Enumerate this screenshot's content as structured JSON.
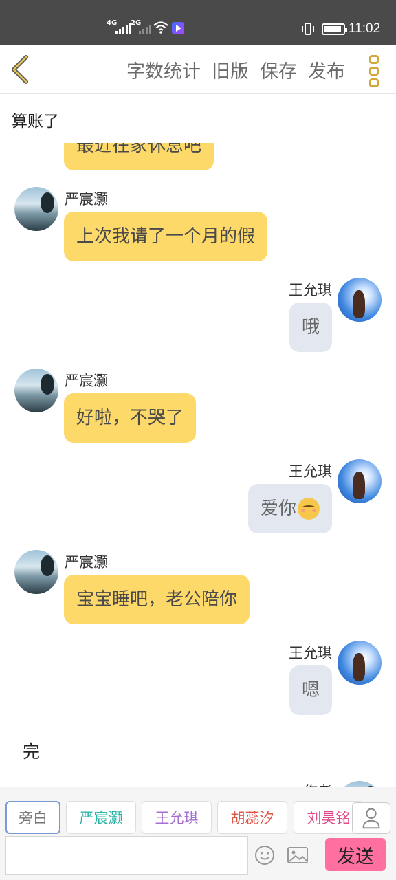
{
  "status_bar": {
    "net1": "4G",
    "net2": "2G",
    "time": "11:02",
    "icons": [
      "signal-icon",
      "wifi-icon",
      "app-icon",
      "vibrate-icon",
      "battery-icon"
    ]
  },
  "toolbar": {
    "back_icon": "chevron-left-icon",
    "word_count": "字数统计",
    "old_version": "旧版",
    "save": "保存",
    "publish": "发布",
    "more_icon": "more-vertical-icon",
    "accent": "#d4a73b"
  },
  "title": "算账了",
  "messages": [
    {
      "side": "left",
      "name": "",
      "text": "最近在家休息吧"
    },
    {
      "side": "left",
      "name": "严宸灏",
      "text": "上次我请了一个月的假"
    },
    {
      "side": "right",
      "name": "王允琪",
      "text": "哦"
    },
    {
      "side": "left",
      "name": "严宸灏",
      "text": "好啦，不哭了"
    },
    {
      "side": "right",
      "name": "王允琪",
      "text": "爱你",
      "emoji": "kissing-face-emoji"
    },
    {
      "side": "left",
      "name": "严宸灏",
      "text": "宝宝睡吧，老公陪你"
    },
    {
      "side": "right",
      "name": "王允琪",
      "text": "嗯"
    },
    {
      "side": "narration",
      "text": "完"
    },
    {
      "side": "right",
      "name": "作者",
      "text": ""
    }
  ],
  "roles": [
    {
      "label": "旁白",
      "color": "#777777",
      "active": true
    },
    {
      "label": "严宸灏",
      "color": "#2bb5a8",
      "active": false
    },
    {
      "label": "王允琪",
      "color": "#a36fd0",
      "active": false
    },
    {
      "label": "胡蕊汐",
      "color": "#e0584a",
      "active": false
    },
    {
      "label": "刘昊铭",
      "color": "#e04a8a",
      "active": false
    }
  ],
  "input": {
    "value": "",
    "placeholder": "",
    "send_label": "发送",
    "send_color": "#ff6fa0"
  },
  "colors": {
    "left_bubble": "#fdd96a",
    "right_bubble": "#e3e8f0"
  }
}
